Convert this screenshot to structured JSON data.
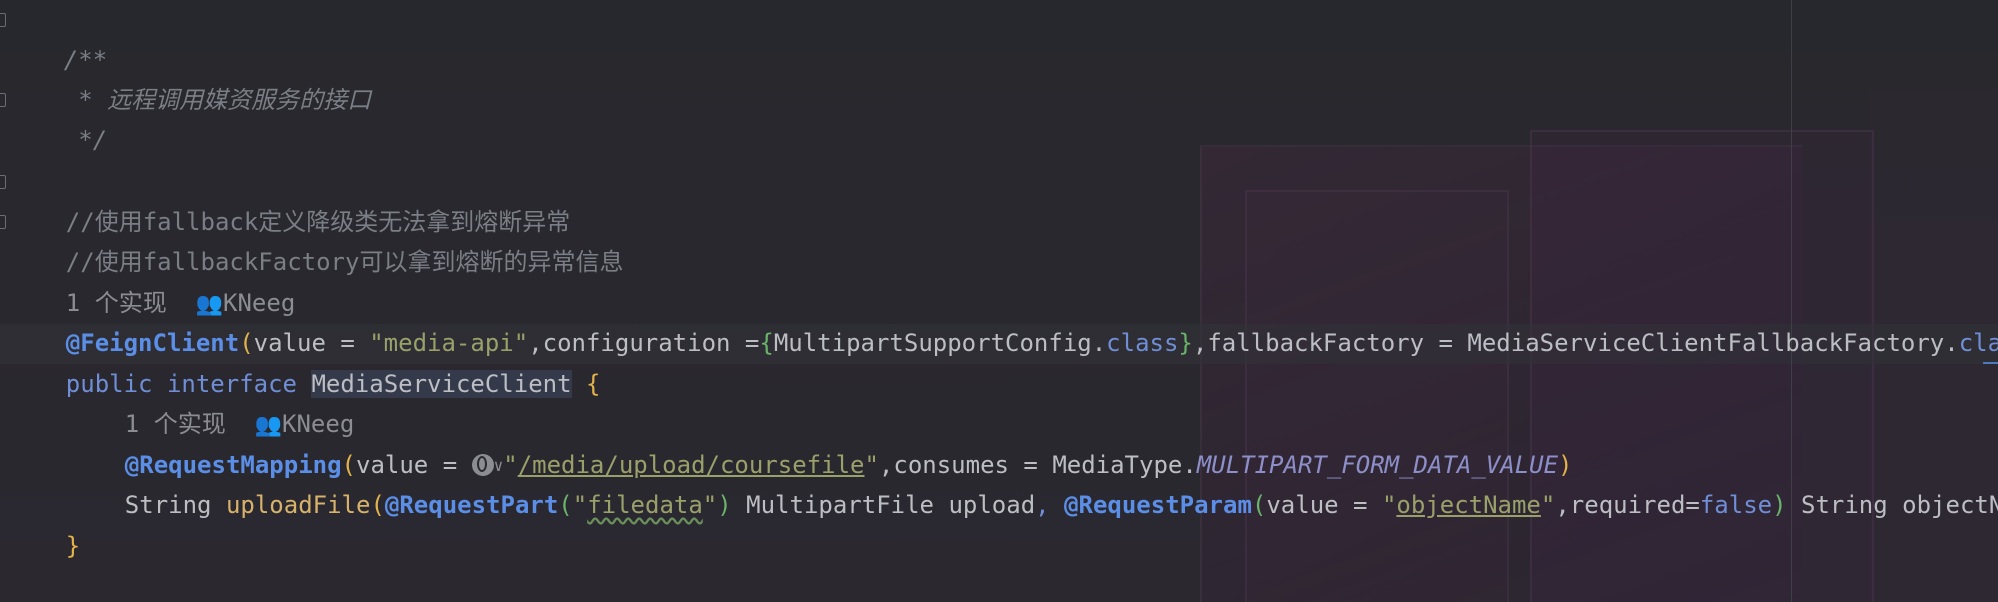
{
  "editor": {
    "lines": {
      "l1": "/**",
      "l2_star": " * ",
      "l2_text": "远程调用媒资服务的接口",
      "l3": " */",
      "l5_prefix": "//使用",
      "l5_word": "fallback",
      "l5_rest": "定义降级类无法拿到熔断异常",
      "l6_prefix": "//使用",
      "l6_word": "fallbackFactory",
      "l6_rest": "可以拿到熔断的异常信息",
      "hint1_count": "1 个实现",
      "hint1_author": "KNeeg",
      "l8_annot": "@FeignClient",
      "l8_p1": "(",
      "l8_t1": "value = ",
      "l8_s1": "\"media-api\"",
      "l8_t2": ",configuration =",
      "l8_b1": "{",
      "l8_t3": "MultipartSupportConfig.",
      "l8_k1": "class",
      "l8_b2": "}",
      "l8_t4": ",fallbackFactory = MediaServiceClientFallbackFactory.",
      "l8_k2": "cla",
      "l9_k1": "public",
      "l9_k2": "interface",
      "l9_name": "MediaServiceClient",
      "l9_brace": "{",
      "hint2_count": "1 个实现",
      "hint2_author": "KNeeg",
      "l11_annot": "@RequestMapping",
      "l11_p1": "(",
      "l11_t1": "value = ",
      "l11_q1": "\"",
      "l11_path": "/media/upload/coursefile",
      "l11_q2": "\"",
      "l11_t2": ",consumes = MediaType.",
      "l11_const": "MULTIPART_FORM_DATA_VALUE",
      "l11_p2": ")",
      "l12_t1": "String ",
      "l12_method": "uploadFile",
      "l12_p1": "(",
      "l12_annot1": "@RequestPart",
      "l12_p2": "(",
      "l12_q1": "\"",
      "l12_s1": "filedata",
      "l12_q2": "\"",
      "l12_p3": ")",
      "l12_t2": " MultipartFile upload",
      "l12_comma": ", ",
      "l12_annot2": "@RequestParam",
      "l12_p4": "(",
      "l12_t3": "value = ",
      "l12_q3": "\"",
      "l12_s2": "objectName",
      "l12_q4": "\"",
      "l12_t4": ",required=",
      "l12_k1": "false",
      "l12_p5": ")",
      "l12_t5": " String objectN",
      "l13": "}"
    }
  },
  "colors": {
    "background": "#27282d",
    "comment": "#7a7e85",
    "keyword": "#6f8ed6",
    "annotation": "#5b8ee6",
    "string": "#9aa06a",
    "method": "#d6b26a",
    "bracket_yellow": "#e2b34a",
    "bracket_green": "#6ab36a",
    "hint_icon": "#e070c0"
  },
  "icons": [
    "fold-icon",
    "people-icon",
    "globe-icon",
    "chevron-down-icon"
  ]
}
